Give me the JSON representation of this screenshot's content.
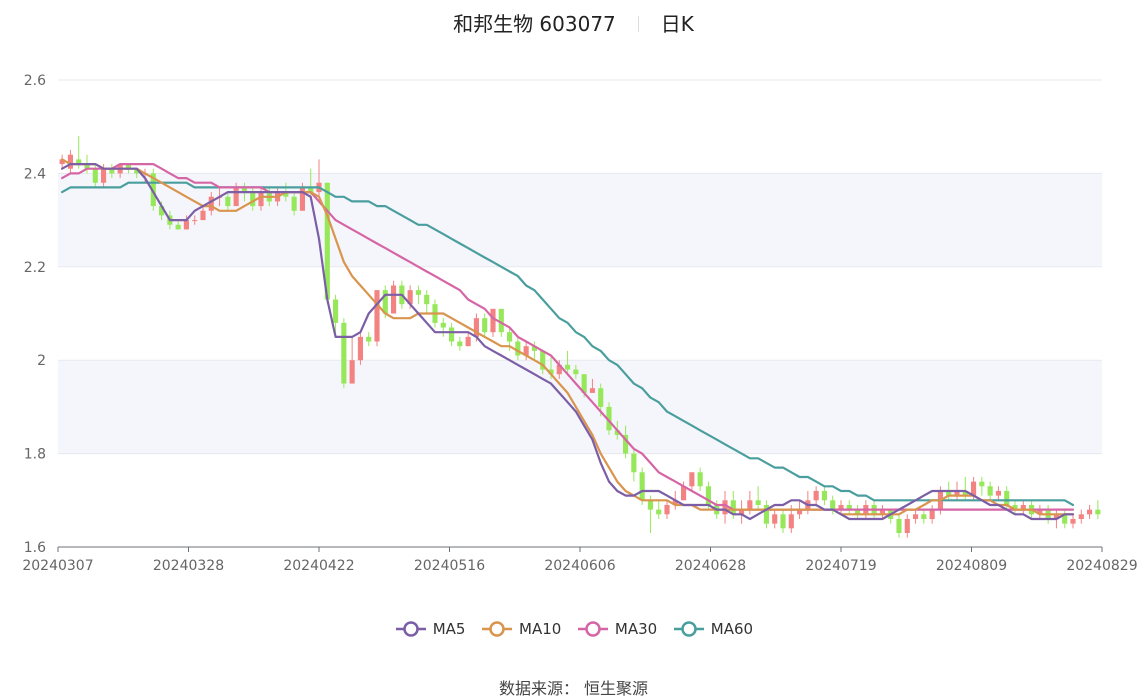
{
  "header": {
    "stock_name_code": "和邦生物 603077",
    "period": "日K"
  },
  "source": "数据来源：  恒生聚源",
  "colors": {
    "up": "#f38282",
    "down": "#96e85a",
    "MA5": "#7b5ea6",
    "MA10": "#d9944e",
    "MA30": "#d665a6",
    "MA60": "#4a9e9e",
    "grid": "#e6e9f0",
    "band": "#f5f6fb",
    "axis": "#666666"
  },
  "chart_data": {
    "type": "candlestick",
    "x_axis_labels": [
      "20240307",
      "20240328",
      "20240422",
      "20240516",
      "20240606",
      "20240628",
      "20240719",
      "20240809",
      "20240829"
    ],
    "y_ticks": [
      "1.6",
      "1.8",
      "2",
      "2.2",
      "2.4",
      "2.6"
    ],
    "ylim": [
      1.6,
      2.6
    ],
    "ma_legend": [
      "MA5",
      "MA10",
      "MA30",
      "MA60"
    ],
    "candles": [
      [
        2.42,
        2.43,
        2.44,
        2.41
      ],
      [
        2.41,
        2.44,
        2.45,
        2.4
      ],
      [
        2.43,
        2.42,
        2.48,
        2.41
      ],
      [
        2.42,
        2.41,
        2.44,
        2.4
      ],
      [
        2.41,
        2.38,
        2.42,
        2.37
      ],
      [
        2.38,
        2.41,
        2.42,
        2.37
      ],
      [
        2.41,
        2.4,
        2.42,
        2.39
      ],
      [
        2.4,
        2.42,
        2.42,
        2.39
      ],
      [
        2.42,
        2.41,
        2.42,
        2.4
      ],
      [
        2.41,
        2.4,
        2.41,
        2.39
      ],
      [
        2.4,
        2.4,
        2.41,
        2.38
      ],
      [
        2.4,
        2.33,
        2.41,
        2.32
      ],
      [
        2.33,
        2.31,
        2.34,
        2.3
      ],
      [
        2.31,
        2.29,
        2.32,
        2.28
      ],
      [
        2.29,
        2.28,
        2.3,
        2.28
      ],
      [
        2.28,
        2.3,
        2.31,
        2.28
      ],
      [
        2.3,
        2.3,
        2.31,
        2.29
      ],
      [
        2.3,
        2.32,
        2.33,
        2.3
      ],
      [
        2.32,
        2.35,
        2.36,
        2.31
      ],
      [
        2.35,
        2.35,
        2.37,
        2.33
      ],
      [
        2.35,
        2.33,
        2.36,
        2.32
      ],
      [
        2.33,
        2.37,
        2.38,
        2.33
      ],
      [
        2.37,
        2.36,
        2.38,
        2.34
      ],
      [
        2.36,
        2.33,
        2.37,
        2.32
      ],
      [
        2.33,
        2.36,
        2.37,
        2.32
      ],
      [
        2.36,
        2.34,
        2.37,
        2.33
      ],
      [
        2.34,
        2.36,
        2.37,
        2.33
      ],
      [
        2.36,
        2.35,
        2.38,
        2.34
      ],
      [
        2.35,
        2.32,
        2.36,
        2.31
      ],
      [
        2.32,
        2.37,
        2.38,
        2.32
      ],
      [
        2.37,
        2.36,
        2.41,
        2.35
      ],
      [
        2.36,
        2.38,
        2.43,
        2.35
      ],
      [
        2.38,
        2.13,
        2.38,
        2.12
      ],
      [
        2.13,
        2.08,
        2.14,
        2.05
      ],
      [
        2.08,
        1.95,
        2.09,
        1.94
      ],
      [
        1.95,
        2.0,
        2.05,
        1.95
      ],
      [
        2.0,
        2.05,
        2.06,
        1.99
      ],
      [
        2.05,
        2.04,
        2.06,
        2.03
      ],
      [
        2.04,
        2.15,
        2.15,
        2.03
      ],
      [
        2.15,
        2.1,
        2.16,
        2.09
      ],
      [
        2.1,
        2.16,
        2.17,
        2.1
      ],
      [
        2.16,
        2.12,
        2.17,
        2.11
      ],
      [
        2.12,
        2.15,
        2.16,
        2.11
      ],
      [
        2.15,
        2.14,
        2.16,
        2.12
      ],
      [
        2.14,
        2.12,
        2.15,
        2.1
      ],
      [
        2.12,
        2.08,
        2.13,
        2.07
      ],
      [
        2.08,
        2.07,
        2.09,
        2.05
      ],
      [
        2.07,
        2.04,
        2.08,
        2.03
      ],
      [
        2.04,
        2.03,
        2.05,
        2.02
      ],
      [
        2.03,
        2.05,
        2.06,
        2.03
      ],
      [
        2.05,
        2.09,
        2.1,
        2.04
      ],
      [
        2.09,
        2.06,
        2.1,
        2.05
      ],
      [
        2.06,
        2.11,
        2.11,
        2.05
      ],
      [
        2.11,
        2.06,
        2.11,
        2.05
      ],
      [
        2.06,
        2.04,
        2.07,
        2.02
      ],
      [
        2.04,
        2.01,
        2.05,
        2.0
      ],
      [
        2.01,
        2.03,
        2.04,
        2.0
      ],
      [
        2.03,
        2.02,
        2.04,
        2.0
      ],
      [
        2.02,
        1.98,
        2.02,
        1.97
      ],
      [
        1.98,
        1.97,
        2.01,
        1.96
      ],
      [
        1.97,
        1.99,
        2.0,
        1.96
      ],
      [
        1.99,
        1.98,
        2.02,
        1.97
      ],
      [
        1.98,
        1.97,
        1.99,
        1.96
      ],
      [
        1.97,
        1.93,
        1.97,
        1.92
      ],
      [
        1.93,
        1.94,
        1.96,
        1.93
      ],
      [
        1.94,
        1.9,
        1.95,
        1.88
      ],
      [
        1.9,
        1.85,
        1.91,
        1.84
      ],
      [
        1.85,
        1.84,
        1.87,
        1.83
      ],
      [
        1.84,
        1.8,
        1.86,
        1.79
      ],
      [
        1.8,
        1.76,
        1.81,
        1.74
      ],
      [
        1.76,
        1.7,
        1.77,
        1.69
      ],
      [
        1.7,
        1.68,
        1.71,
        1.63
      ],
      [
        1.68,
        1.67,
        1.7,
        1.66
      ],
      [
        1.67,
        1.69,
        1.7,
        1.66
      ],
      [
        1.69,
        1.7,
        1.72,
        1.68
      ],
      [
        1.7,
        1.73,
        1.74,
        1.7
      ],
      [
        1.73,
        1.76,
        1.76,
        1.72
      ],
      [
        1.76,
        1.73,
        1.77,
        1.72
      ],
      [
        1.73,
        1.69,
        1.74,
        1.68
      ],
      [
        1.69,
        1.67,
        1.7,
        1.66
      ],
      [
        1.67,
        1.7,
        1.72,
        1.65
      ],
      [
        1.7,
        1.67,
        1.72,
        1.66
      ],
      [
        1.67,
        1.68,
        1.7,
        1.65
      ],
      [
        1.68,
        1.7,
        1.72,
        1.67
      ],
      [
        1.7,
        1.69,
        1.73,
        1.68
      ],
      [
        1.69,
        1.65,
        1.7,
        1.64
      ],
      [
        1.65,
        1.67,
        1.68,
        1.64
      ],
      [
        1.67,
        1.64,
        1.68,
        1.63
      ],
      [
        1.64,
        1.67,
        1.69,
        1.63
      ],
      [
        1.67,
        1.68,
        1.7,
        1.66
      ],
      [
        1.68,
        1.7,
        1.72,
        1.67
      ],
      [
        1.7,
        1.72,
        1.73,
        1.69
      ],
      [
        1.72,
        1.7,
        1.73,
        1.69
      ],
      [
        1.7,
        1.68,
        1.71,
        1.67
      ],
      [
        1.68,
        1.69,
        1.7,
        1.67
      ],
      [
        1.69,
        1.68,
        1.7,
        1.67
      ],
      [
        1.68,
        1.67,
        1.69,
        1.66
      ],
      [
        1.67,
        1.69,
        1.7,
        1.66
      ],
      [
        1.69,
        1.67,
        1.7,
        1.66
      ],
      [
        1.67,
        1.68,
        1.69,
        1.66
      ],
      [
        1.68,
        1.66,
        1.68,
        1.65
      ],
      [
        1.66,
        1.63,
        1.67,
        1.62
      ],
      [
        1.63,
        1.66,
        1.67,
        1.62
      ],
      [
        1.66,
        1.67,
        1.68,
        1.65
      ],
      [
        1.67,
        1.66,
        1.68,
        1.65
      ],
      [
        1.66,
        1.68,
        1.69,
        1.65
      ],
      [
        1.68,
        1.72,
        1.73,
        1.67
      ],
      [
        1.72,
        1.71,
        1.74,
        1.7
      ],
      [
        1.71,
        1.72,
        1.74,
        1.7
      ],
      [
        1.72,
        1.71,
        1.75,
        1.7
      ],
      [
        1.71,
        1.74,
        1.75,
        1.7
      ],
      [
        1.74,
        1.73,
        1.75,
        1.71
      ],
      [
        1.73,
        1.71,
        1.74,
        1.7
      ],
      [
        1.71,
        1.72,
        1.73,
        1.7
      ],
      [
        1.72,
        1.69,
        1.73,
        1.68
      ],
      [
        1.69,
        1.68,
        1.7,
        1.67
      ],
      [
        1.68,
        1.69,
        1.7,
        1.67
      ],
      [
        1.69,
        1.67,
        1.7,
        1.66
      ],
      [
        1.67,
        1.68,
        1.69,
        1.66
      ],
      [
        1.68,
        1.66,
        1.69,
        1.65
      ],
      [
        1.66,
        1.67,
        1.68,
        1.64
      ],
      [
        1.67,
        1.65,
        1.68,
        1.64
      ],
      [
        1.65,
        1.66,
        1.67,
        1.64
      ],
      [
        1.66,
        1.67,
        1.68,
        1.65
      ],
      [
        1.67,
        1.68,
        1.69,
        1.66
      ],
      [
        1.68,
        1.67,
        1.7,
        1.66
      ]
    ],
    "MA5": [
      2.41,
      2.42,
      2.42,
      2.42,
      2.42,
      2.41,
      2.41,
      2.41,
      2.41,
      2.41,
      2.39,
      2.36,
      2.33,
      2.3,
      2.3,
      2.3,
      2.32,
      2.33,
      2.34,
      2.35,
      2.36,
      2.36,
      2.36,
      2.36,
      2.36,
      2.36,
      2.36,
      2.36,
      2.36,
      2.36,
      2.35,
      2.26,
      2.13,
      2.05,
      2.05,
      2.05,
      2.06,
      2.1,
      2.12,
      2.14,
      2.14,
      2.14,
      2.12,
      2.1,
      2.08,
      2.06,
      2.06,
      2.06,
      2.06,
      2.06,
      2.05,
      2.03,
      2.02,
      2.01,
      2.0,
      1.99,
      1.98,
      1.97,
      1.96,
      1.95,
      1.93,
      1.91,
      1.89,
      1.86,
      1.83,
      1.78,
      1.74,
      1.72,
      1.71,
      1.71,
      1.72,
      1.72,
      1.72,
      1.71,
      1.7,
      1.69,
      1.69,
      1.69,
      1.69,
      1.68,
      1.68,
      1.67,
      1.67,
      1.66,
      1.67,
      1.68,
      1.69,
      1.69,
      1.7,
      1.7,
      1.69,
      1.69,
      1.68,
      1.68,
      1.67,
      1.66,
      1.66,
      1.66,
      1.66,
      1.66,
      1.67,
      1.68,
      1.69,
      1.7,
      1.71,
      1.72,
      1.72,
      1.72,
      1.72,
      1.72,
      1.71,
      1.7,
      1.69,
      1.69,
      1.68,
      1.67,
      1.67,
      1.66,
      1.66,
      1.66,
      1.66,
      1.67,
      1.67
    ],
    "MA10": [
      2.43,
      2.42,
      2.42,
      2.42,
      2.42,
      2.41,
      2.41,
      2.41,
      2.41,
      2.41,
      2.4,
      2.39,
      2.38,
      2.37,
      2.36,
      2.35,
      2.34,
      2.33,
      2.33,
      2.32,
      2.32,
      2.32,
      2.33,
      2.34,
      2.35,
      2.35,
      2.35,
      2.36,
      2.36,
      2.36,
      2.36,
      2.35,
      2.31,
      2.26,
      2.21,
      2.18,
      2.16,
      2.14,
      2.12,
      2.1,
      2.09,
      2.09,
      2.09,
      2.1,
      2.1,
      2.1,
      2.1,
      2.09,
      2.08,
      2.07,
      2.06,
      2.05,
      2.04,
      2.03,
      2.03,
      2.02,
      2.01,
      2.0,
      1.99,
      1.97,
      1.95,
      1.93,
      1.9,
      1.87,
      1.84,
      1.8,
      1.77,
      1.74,
      1.72,
      1.71,
      1.7,
      1.7,
      1.7,
      1.7,
      1.69,
      1.69,
      1.69,
      1.68,
      1.68,
      1.68,
      1.68,
      1.68,
      1.68,
      1.68,
      1.68,
      1.68,
      1.68,
      1.68,
      1.68,
      1.68,
      1.68,
      1.68,
      1.68,
      1.68,
      1.67,
      1.67,
      1.67,
      1.67,
      1.67,
      1.67,
      1.67,
      1.67,
      1.68,
      1.68,
      1.69,
      1.7,
      1.7,
      1.71,
      1.71,
      1.71,
      1.71,
      1.7,
      1.7,
      1.69,
      1.69,
      1.68,
      1.68,
      1.68,
      1.67,
      1.67,
      1.67,
      1.67,
      1.67
    ],
    "MA30": [
      2.39,
      2.4,
      2.4,
      2.41,
      2.41,
      2.41,
      2.41,
      2.42,
      2.42,
      2.42,
      2.42,
      2.42,
      2.41,
      2.4,
      2.39,
      2.39,
      2.38,
      2.38,
      2.38,
      2.37,
      2.37,
      2.37,
      2.37,
      2.37,
      2.37,
      2.36,
      2.36,
      2.36,
      2.36,
      2.36,
      2.36,
      2.34,
      2.32,
      2.3,
      2.29,
      2.28,
      2.27,
      2.26,
      2.25,
      2.24,
      2.23,
      2.22,
      2.21,
      2.2,
      2.19,
      2.18,
      2.17,
      2.16,
      2.15,
      2.13,
      2.12,
      2.11,
      2.09,
      2.08,
      2.07,
      2.05,
      2.04,
      2.03,
      2.02,
      2.01,
      1.99,
      1.97,
      1.95,
      1.93,
      1.91,
      1.89,
      1.87,
      1.85,
      1.83,
      1.81,
      1.8,
      1.78,
      1.76,
      1.75,
      1.74,
      1.73,
      1.72,
      1.71,
      1.7,
      1.69,
      1.69,
      1.68,
      1.68,
      1.68,
      1.68,
      1.68,
      1.68,
      1.68,
      1.68,
      1.68,
      1.68,
      1.68,
      1.68,
      1.68,
      1.68,
      1.68,
      1.68,
      1.68,
      1.68,
      1.68,
      1.68,
      1.68,
      1.68,
      1.68,
      1.68,
      1.68,
      1.68,
      1.68,
      1.68,
      1.68,
      1.68,
      1.68,
      1.68,
      1.68,
      1.68,
      1.68,
      1.68,
      1.68,
      1.68,
      1.68,
      1.68,
      1.68,
      1.68
    ],
    "MA60": [
      2.36,
      2.37,
      2.37,
      2.37,
      2.37,
      2.37,
      2.37,
      2.37,
      2.38,
      2.38,
      2.38,
      2.38,
      2.38,
      2.38,
      2.38,
      2.38,
      2.37,
      2.37,
      2.37,
      2.37,
      2.37,
      2.37,
      2.37,
      2.37,
      2.37,
      2.37,
      2.37,
      2.37,
      2.37,
      2.37,
      2.37,
      2.37,
      2.36,
      2.35,
      2.35,
      2.34,
      2.34,
      2.34,
      2.33,
      2.33,
      2.32,
      2.31,
      2.3,
      2.29,
      2.29,
      2.28,
      2.27,
      2.26,
      2.25,
      2.24,
      2.23,
      2.22,
      2.21,
      2.2,
      2.19,
      2.18,
      2.16,
      2.15,
      2.13,
      2.11,
      2.09,
      2.08,
      2.06,
      2.05,
      2.03,
      2.02,
      2.0,
      1.99,
      1.97,
      1.95,
      1.94,
      1.92,
      1.91,
      1.89,
      1.88,
      1.87,
      1.86,
      1.85,
      1.84,
      1.83,
      1.82,
      1.81,
      1.8,
      1.79,
      1.79,
      1.78,
      1.77,
      1.77,
      1.76,
      1.75,
      1.75,
      1.74,
      1.73,
      1.73,
      1.72,
      1.72,
      1.71,
      1.71,
      1.7,
      1.7,
      1.7,
      1.7,
      1.7,
      1.7,
      1.7,
      1.7,
      1.7,
      1.7,
      1.7,
      1.7,
      1.7,
      1.7,
      1.7,
      1.7,
      1.7,
      1.7,
      1.7,
      1.7,
      1.7,
      1.7,
      1.7,
      1.7,
      1.69
    ]
  }
}
